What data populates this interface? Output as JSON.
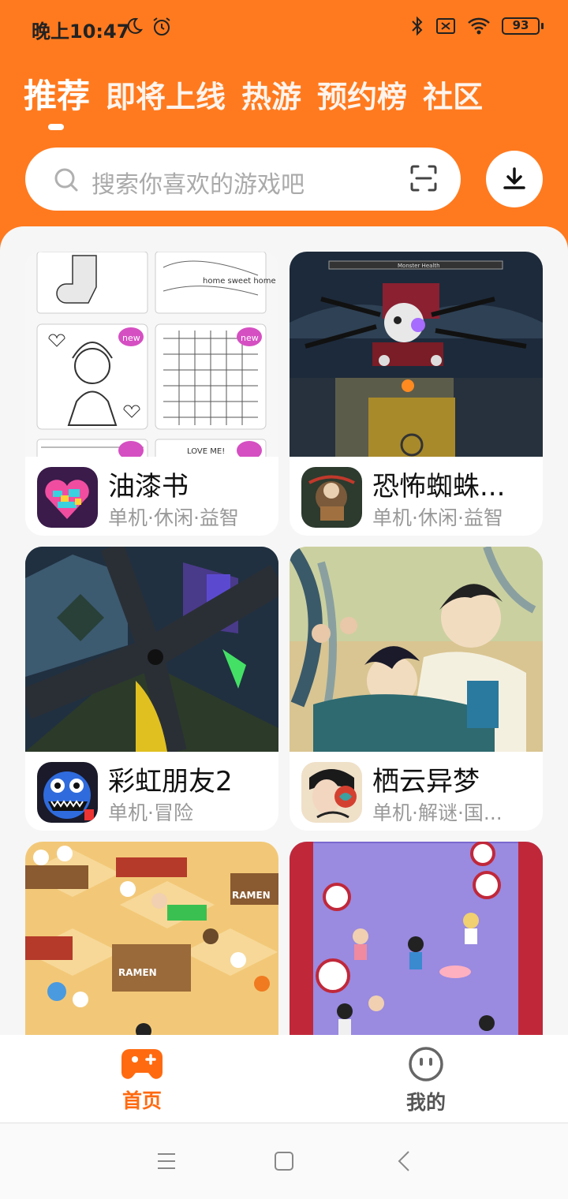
{
  "status_bar": {
    "time": "晚上10:47",
    "battery": "93",
    "icons": [
      "moon-icon",
      "alarm-icon",
      "bluetooth-icon",
      "sim-off-icon",
      "wifi-icon",
      "battery-icon"
    ]
  },
  "tabs": [
    {
      "label": "推荐",
      "active": true
    },
    {
      "label": "即将上线",
      "active": false
    },
    {
      "label": "热游",
      "active": false
    },
    {
      "label": "预约榜",
      "active": false
    },
    {
      "label": "社区",
      "active": false
    }
  ],
  "search": {
    "placeholder": "搜索你喜欢的游戏吧",
    "icon": "search-icon",
    "scan_icon": "scan-icon"
  },
  "download_icon": "download-icon",
  "games": [
    {
      "title": "油漆书",
      "tags": "单机·休闲·益智"
    },
    {
      "title": "恐怖蜘蛛...",
      "tags": "单机·休闲·益智"
    },
    {
      "title": "彩虹朋友2",
      "tags": "单机·冒险"
    },
    {
      "title": "栖云异梦",
      "tags": "单机·解谜·国..."
    },
    {
      "title": "",
      "tags": ""
    },
    {
      "title": "",
      "tags": ""
    }
  ],
  "thumbnail_text": {
    "monster_health": "Monster Health",
    "new_badge": "new",
    "love_me": "LOVE ME!",
    "home_sweet_home": "home sweet home",
    "ramen": "RAMEN"
  },
  "bottom_nav": [
    {
      "label": "首页",
      "icon": "gamepad-icon",
      "active": true
    },
    {
      "label": "我的",
      "icon": "face-icon",
      "active": false
    }
  ],
  "colors": {
    "accent": "#ff7a1f",
    "nav_active": "#ff6a10",
    "nav_inactive": "#666666"
  }
}
